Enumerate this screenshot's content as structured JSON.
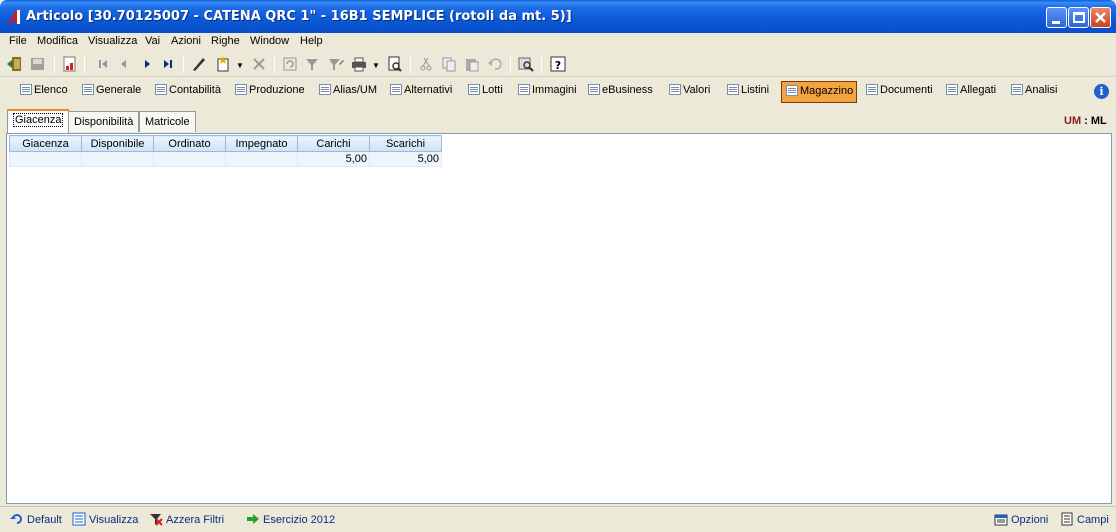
{
  "window": {
    "title": "Articolo [30.70125007 - CATENA QRC 1\" - 16B1 SEMPLICE (rotoli da mt. 5)]"
  },
  "menu": [
    "File",
    "Modifica",
    "Visualizza",
    "Vai",
    "Azioni",
    "Righe",
    "Window",
    "Help"
  ],
  "toolbar_icons": [
    "exit-icon",
    "save-icon",
    "report-icon",
    "first-record-icon",
    "prev-record-icon",
    "next-record-icon",
    "last-record-icon",
    "edit-icon",
    "new-icon",
    "delete-icon",
    "refresh-icon",
    "filter-icon",
    "filter-edit-icon",
    "print-icon",
    "preview-icon",
    "cut-icon",
    "copy-icon",
    "paste-icon",
    "undo-icon",
    "zoom-icon",
    "help-icon"
  ],
  "nav_tabs": [
    "Elenco",
    "Generale",
    "Contabilità",
    "Produzione",
    "Alias/UM",
    "Alternativi",
    "Lotti",
    "Immagini",
    "eBusiness",
    "Valori",
    "Listini",
    "Magazzino",
    "Documenti",
    "Allegati",
    "Analisi"
  ],
  "nav_active": "Magazzino",
  "sub_tabs": [
    "Giacenza",
    "Disponibilità",
    "Matricole"
  ],
  "sub_active": "Giacenza",
  "um": {
    "label": "UM",
    "sep": " : ",
    "value": "ML"
  },
  "grid": {
    "columns": [
      "Giacenza",
      "Disponibile",
      "Ordinato",
      "Impegnato",
      "Carichi",
      "Scarichi"
    ],
    "rows": [
      [
        "",
        "",
        "",
        "",
        "5,00",
        "5,00"
      ]
    ]
  },
  "status": {
    "default": "Default",
    "visualizza": "Visualizza",
    "azzera": "Azzera Filtri",
    "esercizio": "Esercizio 2012",
    "opzioni": "Opzioni",
    "campi": "Campi"
  },
  "colors": {
    "title_bar": "#0b58d6",
    "active_tab": "#f4a342",
    "um_label": "#8b1a1a",
    "status_text": "#0a2a8a"
  }
}
